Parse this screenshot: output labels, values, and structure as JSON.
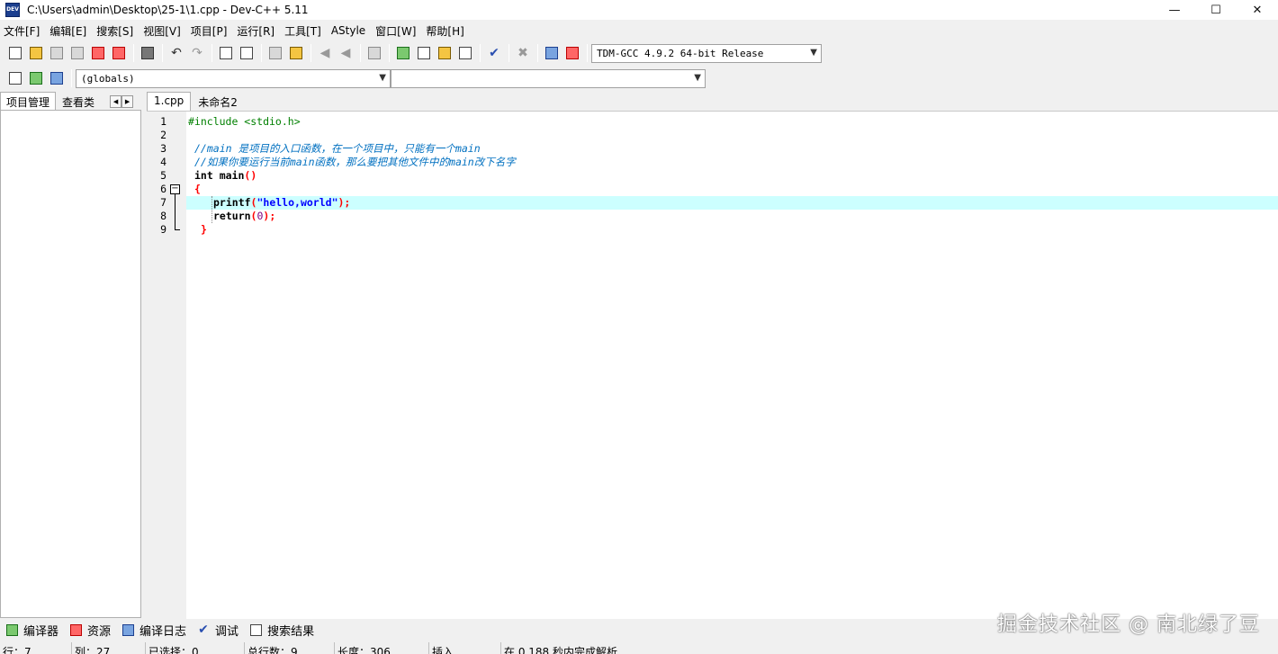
{
  "window": {
    "app_icon_text": "DEV",
    "title": "C:\\Users\\admin\\Desktop\\25-1\\1.cpp - Dev-C++ 5.11",
    "minimize": "—",
    "maximize": "☐",
    "close": "✕"
  },
  "menu": [
    "文件[F]",
    "编辑[E]",
    "搜索[S]",
    "视图[V]",
    "项目[P]",
    "运行[R]",
    "工具[T]",
    "AStyle",
    "窗口[W]",
    "帮助[H]"
  ],
  "toolbar": {
    "compiler_select": "TDM-GCC 4.9.2 64-bit Release",
    "scope_select": "(globals)",
    "function_select": ""
  },
  "left_panel": {
    "tabs": [
      "项目管理",
      "查看类"
    ],
    "nav_prev": "◀",
    "nav_next": "▶"
  },
  "editor": {
    "tabs": [
      "1.cpp",
      "未命名2"
    ],
    "line_numbers": [
      "1",
      "2",
      "3",
      "4",
      "5",
      "6",
      "7",
      "8",
      "9"
    ],
    "fold_symbol": "−",
    "code": {
      "l1_pp": "#include <stdio.h>",
      "l3_comment": "//main 是项目的入口函数，在一个项目中，只能有一个main",
      "l4_comment": "//如果你要运行当前main函数，那么要把其他文件中的main改下名字",
      "l5_kw": "int",
      "l5_id": " main",
      "l5_sym": "()",
      "l6_sym": "{",
      "l7_id": "printf",
      "l7_sym1": "(",
      "l7_str": "\"hello,world\"",
      "l7_sym2": ");",
      "l8_kw": "return",
      "l8_sym1": "(",
      "l8_num": "0",
      "l8_sym2": ");",
      "l9_sym": "}"
    }
  },
  "bottom_tabs": [
    "编译器",
    "资源",
    "编译日志",
    "调试",
    "搜索结果"
  ],
  "watermark": "掘金技术社区 @ 南北绿了豆",
  "status": {
    "row": "行：7",
    "col": "列：27",
    "selected": "已选择：0",
    "total_lines": "总行数：9",
    "length": "长度：306",
    "mode": "插入",
    "parse": "在 0.188 秒内完成解析"
  }
}
